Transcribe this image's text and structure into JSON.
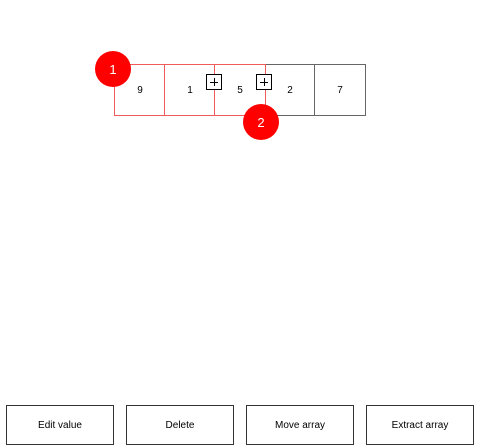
{
  "array": {
    "cells": [
      "9",
      "1",
      "5",
      "2",
      "7"
    ],
    "selected_range": "cells 1-3"
  },
  "badges": {
    "start": "1",
    "end": "2"
  },
  "accent_color": "#ff0000",
  "selection_color": "#f05a5a",
  "insert_icon": "plus-icon",
  "buttons": {
    "edit_value": "Edit value",
    "delete": "Delete",
    "move_array": "Move array",
    "extract_array": "Extract array"
  }
}
